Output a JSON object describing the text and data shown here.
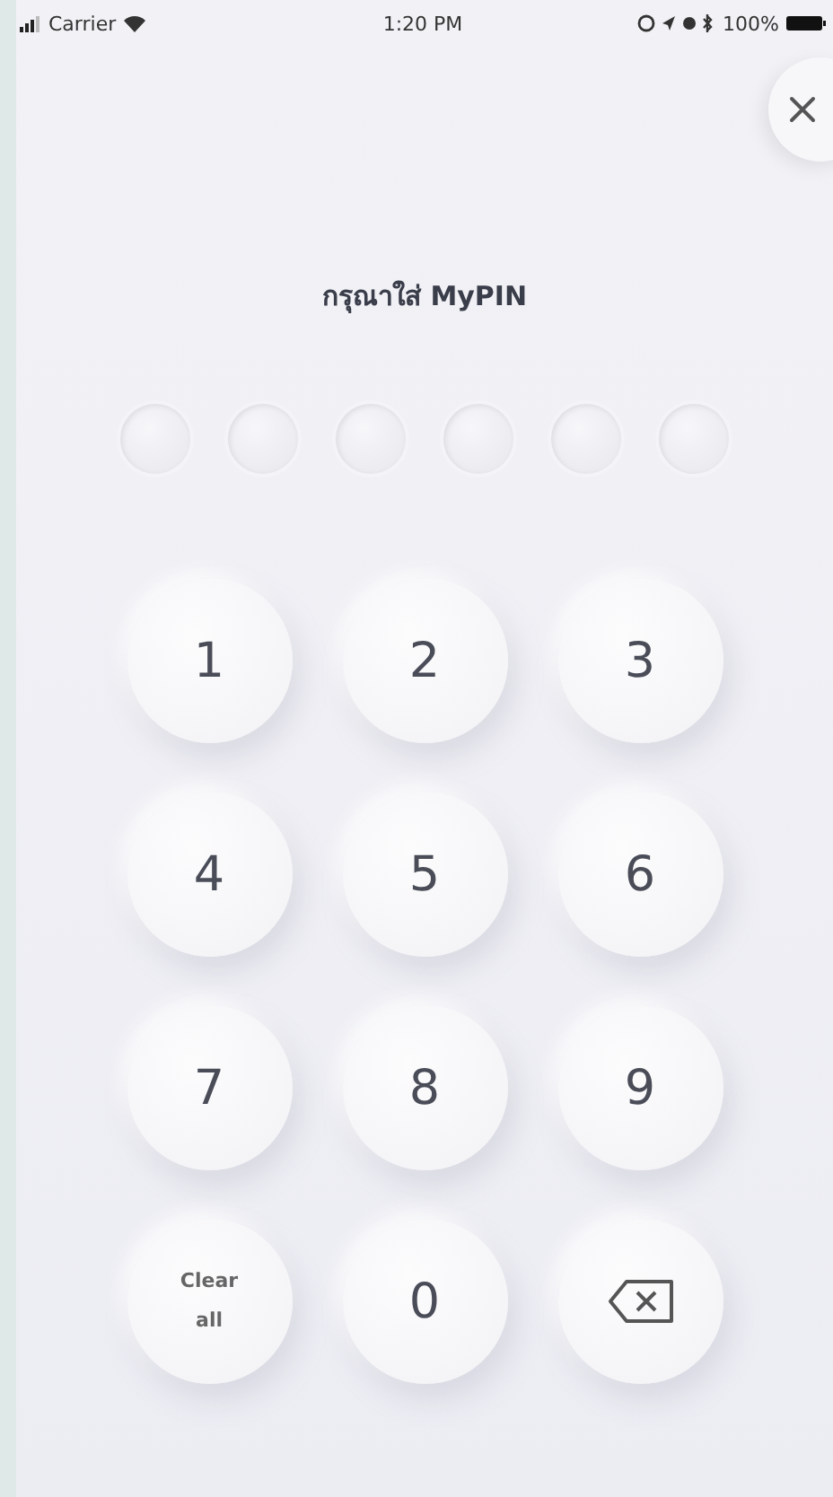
{
  "status_bar": {
    "carrier": "Carrier",
    "time": "1:20 PM",
    "battery": "100%"
  },
  "title": "กรุณาใส่ MyPIN",
  "pin_dots": [
    {
      "filled": false
    },
    {
      "filled": false
    },
    {
      "filled": false
    },
    {
      "filled": false
    },
    {
      "filled": false
    },
    {
      "filled": false
    }
  ],
  "keys": [
    {
      "kind": "digit",
      "label": "1"
    },
    {
      "kind": "digit",
      "label": "2"
    },
    {
      "kind": "digit",
      "label": "3"
    },
    {
      "kind": "digit",
      "label": "4"
    },
    {
      "kind": "digit",
      "label": "5"
    },
    {
      "kind": "digit",
      "label": "6"
    },
    {
      "kind": "digit",
      "label": "7"
    },
    {
      "kind": "digit",
      "label": "8"
    },
    {
      "kind": "digit",
      "label": "9"
    },
    {
      "kind": "text",
      "label": "Clear all"
    },
    {
      "kind": "digit",
      "label": "0"
    },
    {
      "kind": "backspace"
    }
  ]
}
